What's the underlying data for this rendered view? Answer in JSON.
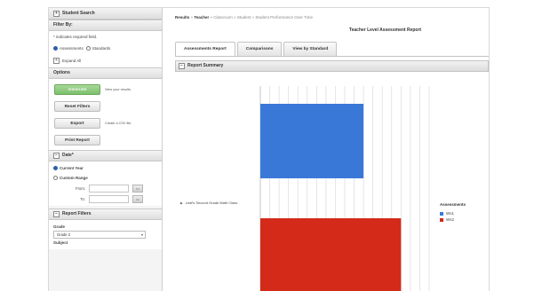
{
  "sidebar": {
    "student_search": "Student Search",
    "filter_by": "Filter By:",
    "required_note": "* indicates required field.",
    "radio_assessments": "Assessments",
    "radio_standards": "Standards",
    "expand_all": "Expand All",
    "options": "Options",
    "generate_btn": "Generate",
    "generate_hint": "View your results.",
    "reset_btn": "Reset Filters",
    "export_btn": "Export",
    "export_hint": "Create a CSV file.",
    "print_btn": "Print Report",
    "date_head": "Date*",
    "current_year": "Current Year",
    "custom_range": "Custom Range",
    "from_label": "From:",
    "to_label": "To:",
    "cal_glyph": "▭",
    "report_filters": "Report Filters",
    "grade_label": "Grade",
    "grade_value": "Grade 2",
    "subject_label": "Subject"
  },
  "main": {
    "crumbs": {
      "results": "Results",
      "teacher": "Teacher",
      "classroom": "Classroom",
      "student": "Student",
      "current": "Student Performance Over Time",
      "sep": "»"
    },
    "report_title": "Teacher Level Assessment Report",
    "tabs": [
      "Assessments Report",
      "Comparisons",
      "View by Standard"
    ],
    "panel_title": "Report Summary"
  },
  "chart_data": {
    "type": "bar",
    "orientation": "horizontal",
    "categories": [
      "Leaf's Second Grade Math Class"
    ],
    "series": [
      {
        "name": "Ws1",
        "color": "#3a78d8",
        "values": [
          55
        ]
      },
      {
        "name": "Ws2",
        "color": "#d42a1a",
        "values": [
          75
        ]
      }
    ],
    "legend_title": "Assessments",
    "legend_position": "right",
    "xlim": [
      0,
      90
    ],
    "grid": true
  },
  "colors": {
    "accent": "#2c5fa8",
    "generate": "#7cbf6c"
  }
}
